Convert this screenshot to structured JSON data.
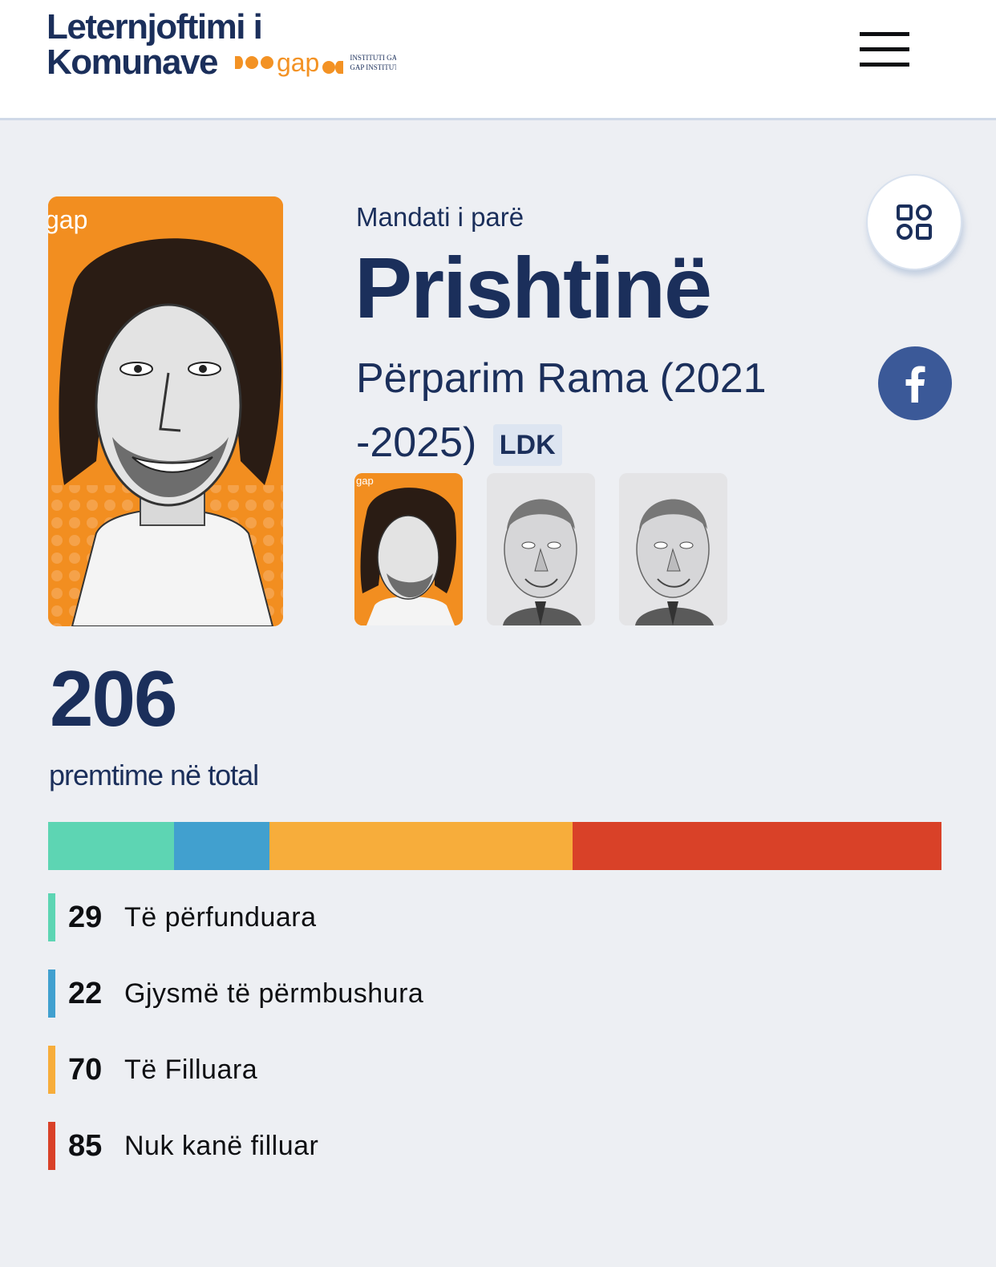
{
  "header": {
    "logo_line1": "Leternjoftimi i",
    "logo_line2": "Komunave",
    "gap_word": "gap",
    "gap_institute_line1": "INSTITUTI GA",
    "gap_institute_line2": "GAP INSTITUT"
  },
  "profile": {
    "mandate": "Mandati i parë",
    "city": "Prishtinë",
    "mayor": "Përparim Rama (2021 -2025)",
    "party": "LDK",
    "portrait_watermark": "gap",
    "thumb_watermark": "gap"
  },
  "totals": {
    "count": "206",
    "label": "premtime në total"
  },
  "status": [
    {
      "count": "29",
      "label": "Të përfunduara",
      "color": "#5dd5b3",
      "value": 29
    },
    {
      "count": "22",
      "label": "Gjysmë të përmbushura",
      "color": "#41a0cf",
      "value": 22
    },
    {
      "count": "70",
      "label": "Të Filluara",
      "color": "#f7ad3b",
      "value": 70
    },
    {
      "count": "85",
      "label": "Nuk kanë filluar",
      "color": "#d94128",
      "value": 85
    }
  ],
  "colors": {
    "navy": "#1b2f5b",
    "orange": "#f28e20",
    "facebook": "#3b5998",
    "background": "#edeff3"
  },
  "icons": {
    "menu": "hamburger-icon",
    "grid": "grid-icon",
    "facebook": "facebook-icon"
  }
}
